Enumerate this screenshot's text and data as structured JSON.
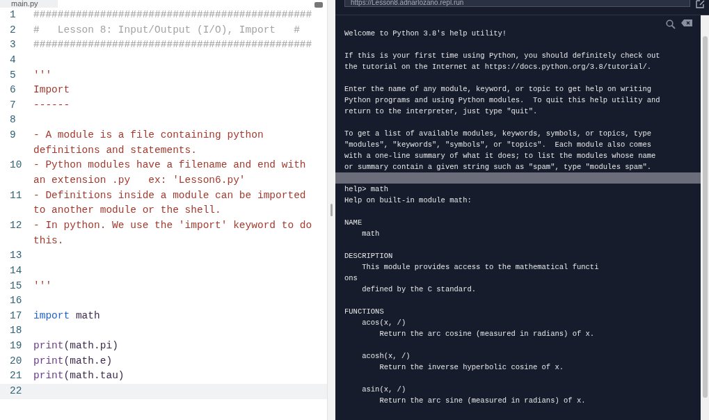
{
  "editor": {
    "tab": {
      "label": "main.py",
      "selected": true
    },
    "lines": [
      {
        "number": "1",
        "current": false,
        "segments": [
          {
            "kind": "comment",
            "text": "##############################################"
          }
        ]
      },
      {
        "number": "2",
        "current": false,
        "segments": [
          {
            "kind": "comment",
            "text": "#   Lesson 8: Input/Output (I/O), Import   #"
          }
        ]
      },
      {
        "number": "3",
        "current": false,
        "segments": [
          {
            "kind": "comment",
            "text": "##############################################"
          }
        ]
      },
      {
        "number": "4",
        "current": false
      },
      {
        "number": "5",
        "current": false,
        "segments": [
          {
            "kind": "string",
            "text": "'''"
          }
        ]
      },
      {
        "number": "6",
        "current": false,
        "segments": [
          {
            "kind": "string",
            "text": "Import"
          }
        ]
      },
      {
        "number": "7",
        "current": false,
        "segments": [
          {
            "kind": "string",
            "text": "------"
          }
        ]
      },
      {
        "number": "8",
        "current": false
      },
      {
        "number": "9",
        "current": false,
        "segments": [
          {
            "kind": "string",
            "text": "- A module is a file containing python definitions and statements."
          }
        ]
      },
      {
        "number": "10",
        "current": false,
        "segments": [
          {
            "kind": "string",
            "text": "- Python modules have a filename and end with an extension .py   ex: 'Lesson6.py'"
          }
        ]
      },
      {
        "number": "11",
        "current": false,
        "segments": [
          {
            "kind": "string",
            "text": "- Definitions inside a module can be imported to another module or the shell."
          }
        ]
      },
      {
        "number": "12",
        "current": false,
        "segments": [
          {
            "kind": "string",
            "text": "- In python. We use the 'import' keyword to do this."
          }
        ]
      },
      {
        "number": "13",
        "current": false
      },
      {
        "number": "14",
        "current": false
      },
      {
        "number": "15",
        "current": false,
        "segments": [
          {
            "kind": "string",
            "text": "'''"
          }
        ]
      },
      {
        "number": "16",
        "current": false
      },
      {
        "number": "17",
        "current": false,
        "segments": [
          {
            "kind": "keyword",
            "text": "import"
          },
          {
            "kind": "plain",
            "text": " math"
          }
        ]
      },
      {
        "number": "18",
        "current": false
      },
      {
        "number": "19",
        "current": false,
        "segments": [
          {
            "kind": "builtin",
            "text": "print"
          },
          {
            "kind": "plain",
            "text": "(math.pi)"
          }
        ]
      },
      {
        "number": "20",
        "current": false,
        "segments": [
          {
            "kind": "builtin",
            "text": "print"
          },
          {
            "kind": "plain",
            "text": "(math.e)"
          }
        ]
      },
      {
        "number": "21",
        "current": false,
        "segments": [
          {
            "kind": "builtin",
            "text": "print"
          },
          {
            "kind": "plain",
            "text": "(math.tau)"
          }
        ]
      },
      {
        "number": "22",
        "current": true
      }
    ]
  },
  "console": {
    "url": "https://Lesson8.adnarlozano.repl.run",
    "lines": [
      {
        "kind": "text",
        "selected": false,
        "text": "Welcome to Python 3.8's help utility!"
      },
      {
        "kind": "blank",
        "selected": false
      },
      {
        "kind": "text",
        "selected": false,
        "text": "If this is your first time using Python, you should definitely check out"
      },
      {
        "kind": "text",
        "selected": false,
        "text": "the tutorial on the Internet at https://docs.python.org/3.8/tutorial/."
      },
      {
        "kind": "blank",
        "selected": false
      },
      {
        "kind": "text",
        "selected": false,
        "text": "Enter the name of any module, keyword, or topic to get help on writing"
      },
      {
        "kind": "text",
        "selected": false,
        "text": "Python programs and using Python modules.  To quit this help utility and"
      },
      {
        "kind": "text",
        "selected": false,
        "text": "return to the interpreter, just type \"quit\"."
      },
      {
        "kind": "blank",
        "selected": false
      },
      {
        "kind": "text",
        "selected": false,
        "text": "To get a list of available modules, keywords, symbols, or topics, type"
      },
      {
        "kind": "text",
        "selected": false,
        "text": "\"modules\", \"keywords\", \"symbols\", or \"topics\".  Each module also comes"
      },
      {
        "kind": "text",
        "selected": false,
        "text": "with a one-line summary of what it does; to list the modules whose name"
      },
      {
        "kind": "text",
        "selected": false,
        "text": "or summary contain a given string such as \"spam\", type \"modules spam\"."
      },
      {
        "kind": "blank",
        "selected": true
      },
      {
        "kind": "text",
        "selected": false,
        "text": "help> math"
      },
      {
        "kind": "text",
        "selected": false,
        "text": "Help on built-in module math:"
      },
      {
        "kind": "blank",
        "selected": false
      },
      {
        "kind": "text",
        "selected": false,
        "text": "NAME"
      },
      {
        "kind": "text",
        "selected": false,
        "text": "    math"
      },
      {
        "kind": "blank",
        "selected": false
      },
      {
        "kind": "text",
        "selected": false,
        "text": "DESCRIPTION"
      },
      {
        "kind": "text",
        "selected": false,
        "text": "    This module provides access to the mathematical functi"
      },
      {
        "kind": "text",
        "selected": false,
        "text": "ons"
      },
      {
        "kind": "text",
        "selected": false,
        "text": "    defined by the C standard."
      },
      {
        "kind": "blank",
        "selected": false
      },
      {
        "kind": "text",
        "selected": false,
        "text": "FUNCTIONS"
      },
      {
        "kind": "text",
        "selected": false,
        "text": "    acos(x, /)"
      },
      {
        "kind": "text",
        "selected": false,
        "text": "        Return the arc cosine (measured in radians) of x."
      },
      {
        "kind": "blank",
        "selected": false
      },
      {
        "kind": "text",
        "selected": false,
        "text": "    acosh(x, /)"
      },
      {
        "kind": "text",
        "selected": false,
        "text": "        Return the inverse hyperbolic cosine of x."
      },
      {
        "kind": "blank",
        "selected": false
      },
      {
        "kind": "text",
        "selected": false,
        "text": "    asin(x, /)"
      },
      {
        "kind": "text",
        "selected": false,
        "text": "        Return the arc sine (measured in radians) of x."
      }
    ]
  }
}
